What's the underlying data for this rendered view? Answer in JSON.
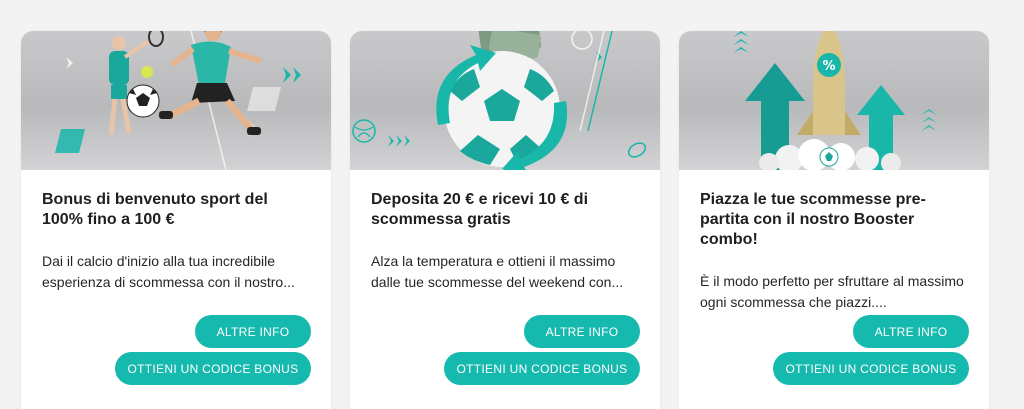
{
  "cards": [
    {
      "title": "Bonus di benvenuto sport del 100% fino a 100 €",
      "description": "Dai il calcio d'inizio alla tua incredibile esperienza di scommessa con il nostro...",
      "info_label": "ALTRE INFO",
      "bonus_label": "OTTIENI UN CODICE BONUS",
      "image": "soccer-tennis-players-illustration"
    },
    {
      "title": "Deposita 20 € e ricevi 10 € di scommessa gratis",
      "description": "Alza la temperatura e ottieni il massimo dalle tue scommesse del weekend con...",
      "info_label": "ALTRE INFO",
      "bonus_label": "OTTIENI UN CODICE BONUS",
      "image": "soccer-ball-money-arrows-illustration"
    },
    {
      "title": "Piazza le tue scommesse pre-partita con il nostro Booster combo!",
      "description": "È il modo perfetto per sfruttare al massimo ogni scommessa che piazzi....",
      "info_label": "ALTRE INFO",
      "bonus_label": "OTTIENI UN CODICE BONUS",
      "image": "rocket-percent-arrows-illustration"
    }
  ],
  "colors": {
    "accent": "#16b9ad",
    "background": "#f3f3f4",
    "card": "#ffffff"
  }
}
